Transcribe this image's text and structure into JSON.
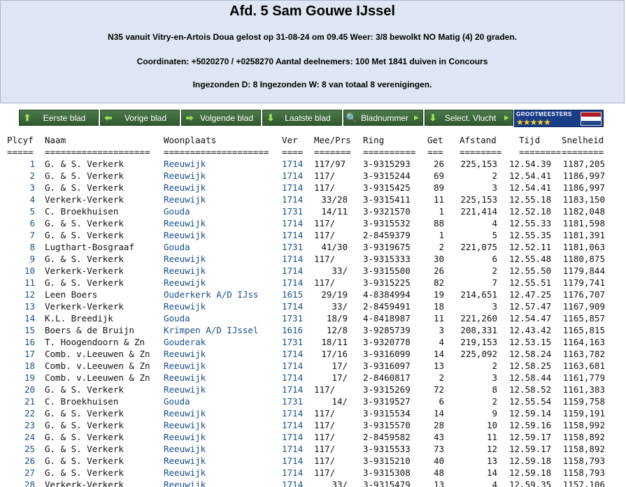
{
  "header": {
    "title": "Afd. 5 Sam Gouwe IJssel",
    "line1": "N35 vanuit Vitry-en-Artois Doua gelost op 31-08-24 om 09.45 Weer: 3/8 bewolkt NO Matig (4) 20 graden.",
    "line2": "Coordinaten: +5020270 / +0258270 Aantal deelnemers: 100 Met 1841 duiven in Concours",
    "line3": "Ingezonden D: 8 Ingezonden W: 8 van totaal 8 verenigingen."
  },
  "nav": {
    "first": "Eerste blad",
    "prev": "Vorige blad",
    "next": "Volgende blad",
    "last": "Laatste blad",
    "page_no": "Bladnummer",
    "select": "Select. Vlucht"
  },
  "logo": {
    "brand": "GROOTMEESTERS",
    "stars": "★★★★★",
    "flag_colors": [
      "#ae1c28",
      "#ffffff",
      "#21468b"
    ]
  },
  "columns": {
    "plc": "Plcyf",
    "naam": "Naam",
    "woon": "Woonplaats",
    "ver": "Ver",
    "mee": "Mee/Prs",
    "ring": "Ring",
    "get": "Get",
    "afs": "Afstand",
    "tijd": "Tijd",
    "snel": "Snelheid"
  },
  "separators": {
    "plc": "=====",
    "naam": "====================",
    "woon": "====================",
    "ver": "====",
    "mee": "=======",
    "ring": "==========",
    "get": "===",
    "afs": "========",
    "tijd": "========",
    "snel": "========"
  },
  "rows": [
    {
      "plc": "1",
      "naam": "G. & S. Verkerk",
      "woon": "Reeuwijk",
      "ver": "1714",
      "mee": "117/97",
      "ring": "3-9315293",
      "get": "26",
      "afs": "225,153",
      "tijd": "12.54.39",
      "snel": "1187,205"
    },
    {
      "plc": "2",
      "naam": "G. & S. Verkerk",
      "woon": "Reeuwijk",
      "ver": "1714",
      "mee": "117/",
      "ring": "3-9315244",
      "get": "69",
      "afs": "2",
      "tijd": "12.54.41",
      "snel": "1186,997"
    },
    {
      "plc": "3",
      "naam": "G. & S. Verkerk",
      "woon": "Reeuwijk",
      "ver": "1714",
      "mee": "117/",
      "ring": "3-9315425",
      "get": "89",
      "afs": "3",
      "tijd": "12.54.41",
      "snel": "1186,997"
    },
    {
      "plc": "4",
      "naam": "Verkerk-Verkerk",
      "woon": "Reeuwijk",
      "ver": "1714",
      "mee": "33/28",
      "ring": "3-9315411",
      "get": "11",
      "afs": "225,153",
      "tijd": "12.55.18",
      "snel": "1183,150"
    },
    {
      "plc": "5",
      "naam": "C. Broekhuisen",
      "woon": "Gouda",
      "ver": "1731",
      "mee": "14/11",
      "ring": "3-9321570",
      "get": "1",
      "afs": "221,414",
      "tijd": "12.52.18",
      "snel": "1182,048"
    },
    {
      "plc": "6",
      "naam": "G. & S. Verkerk",
      "woon": "Reeuwijk",
      "ver": "1714",
      "mee": "117/",
      "ring": "3-9315532",
      "get": "88",
      "afs": "4",
      "tijd": "12.55.33",
      "snel": "1181,598"
    },
    {
      "plc": "7",
      "naam": "G. & S. Verkerk",
      "woon": "Reeuwijk",
      "ver": "1714",
      "mee": "117/",
      "ring": "2-8459379",
      "get": "1",
      "afs": "5",
      "tijd": "12.55.35",
      "snel": "1181,391"
    },
    {
      "plc": "8",
      "naam": "Lugthart-Bosgraaf",
      "woon": "Gouda",
      "ver": "1731",
      "mee": "41/30",
      "ring": "3-9319675",
      "get": "2",
      "afs": "221,075",
      "tijd": "12.52.11",
      "snel": "1181,063"
    },
    {
      "plc": "9",
      "naam": "G. & S. Verkerk",
      "woon": "Reeuwijk",
      "ver": "1714",
      "mee": "117/",
      "ring": "3-9315333",
      "get": "30",
      "afs": "6",
      "tijd": "12.55.48",
      "snel": "1180,875"
    },
    {
      "plc": "10",
      "naam": "Verkerk-Verkerk",
      "woon": "Reeuwijk",
      "ver": "1714",
      "mee": "33/",
      "ring": "3-9315500",
      "get": "26",
      "afs": "2",
      "tijd": "12.55.50",
      "snel": "1179,844"
    },
    {
      "plc": "11",
      "naam": "G. & S. Verkerk",
      "woon": "Reeuwijk",
      "ver": "1714",
      "mee": "117/",
      "ring": "3-9315225",
      "get": "82",
      "afs": "7",
      "tijd": "12.55.51",
      "snel": "1179,741"
    },
    {
      "plc": "12",
      "naam": "Leen Boers",
      "woon": "Ouderkerk A/D IJss",
      "ver": "1615",
      "mee": "29/19",
      "ring": "4-8384994",
      "get": "19",
      "afs": "214,651",
      "tijd": "12.47.25",
      "snel": "1176,707"
    },
    {
      "plc": "13",
      "naam": "Verkerk-Verkerk",
      "woon": "Reeuwijk",
      "ver": "1714",
      "mee": "33/",
      "ring": "2-8459491",
      "get": "18",
      "afs": "3",
      "tijd": "12.57.47",
      "snel": "1167,909"
    },
    {
      "plc": "14",
      "naam": "K.L. Breedijk",
      "woon": "Gouda",
      "ver": "1731",
      "mee": "18/9",
      "ring": "4-8418987",
      "get": "11",
      "afs": "221,260",
      "tijd": "12.54.47",
      "snel": "1165,857"
    },
    {
      "plc": "15",
      "naam": "Boers & de Bruijn",
      "woon": "Krimpen A/D IJssel",
      "ver": "1616",
      "mee": "12/8",
      "ring": "3-9285739",
      "get": "3",
      "afs": "208,331",
      "tijd": "12.43.42",
      "snel": "1165,815"
    },
    {
      "plc": "16",
      "naam": "T. Hoogendoorn & Zn",
      "woon": "Gouderak",
      "ver": "1731",
      "mee": "18/11",
      "ring": "3-9320778",
      "get": "4",
      "afs": "219,153",
      "tijd": "12.53.15",
      "snel": "1164,163"
    },
    {
      "plc": "17",
      "naam": "Comb. v.Leeuwen & Zn",
      "woon": "Reeuwijk",
      "ver": "1714",
      "mee": "17/16",
      "ring": "3-9316099",
      "get": "14",
      "afs": "225,092",
      "tijd": "12.58.24",
      "snel": "1163,782"
    },
    {
      "plc": "18",
      "naam": "Comb. v.Leeuwen & Zn",
      "woon": "Reeuwijk",
      "ver": "1714",
      "mee": "17/",
      "ring": "3-9316097",
      "get": "13",
      "afs": "2",
      "tijd": "12.58.25",
      "snel": "1163,681"
    },
    {
      "plc": "19",
      "naam": "Comb. v.Leeuwen & Zn",
      "woon": "Reeuwijk",
      "ver": "1714",
      "mee": "17/",
      "ring": "2-8460817",
      "get": "2",
      "afs": "3",
      "tijd": "12.58.44",
      "snel": "1161,779"
    },
    {
      "plc": "20",
      "naam": "G. & S. Verkerk",
      "woon": "Reeuwijk",
      "ver": "1714",
      "mee": "117/",
      "ring": "3-9315269",
      "get": "72",
      "afs": "8",
      "tijd": "12.58.52",
      "snel": "1161,383"
    },
    {
      "plc": "21",
      "naam": "C. Broekhuisen",
      "woon": "Gouda",
      "ver": "1731",
      "mee": "14/",
      "ring": "3-9319527",
      "get": "6",
      "afs": "2",
      "tijd": "12.55.54",
      "snel": "1159,758"
    },
    {
      "plc": "22",
      "naam": "G. & S. Verkerk",
      "woon": "Reeuwijk",
      "ver": "1714",
      "mee": "117/",
      "ring": "3-9315534",
      "get": "14",
      "afs": "9",
      "tijd": "12.59.14",
      "snel": "1159,191"
    },
    {
      "plc": "23",
      "naam": "G. & S. Verkerk",
      "woon": "Reeuwijk",
      "ver": "1714",
      "mee": "117/",
      "ring": "3-9315570",
      "get": "28",
      "afs": "10",
      "tijd": "12.59.16",
      "snel": "1158,992"
    },
    {
      "plc": "24",
      "naam": "G. & S. Verkerk",
      "woon": "Reeuwijk",
      "ver": "1714",
      "mee": "117/",
      "ring": "2-8459582",
      "get": "43",
      "afs": "11",
      "tijd": "12.59.17",
      "snel": "1158,892"
    },
    {
      "plc": "25",
      "naam": "G. & S. Verkerk",
      "woon": "Reeuwijk",
      "ver": "1714",
      "mee": "117/",
      "ring": "3-9315533",
      "get": "73",
      "afs": "12",
      "tijd": "12.59.17",
      "snel": "1158,892"
    },
    {
      "plc": "26",
      "naam": "G. & S. Verkerk",
      "woon": "Reeuwijk",
      "ver": "1714",
      "mee": "117/",
      "ring": "3-9315210",
      "get": "40",
      "afs": "13",
      "tijd": "12.59.18",
      "snel": "1158,793"
    },
    {
      "plc": "27",
      "naam": "G. & S. Verkerk",
      "woon": "Reeuwijk",
      "ver": "1714",
      "mee": "117/",
      "ring": "3-9315308",
      "get": "48",
      "afs": "14",
      "tijd": "12.59.18",
      "snel": "1158,793"
    },
    {
      "plc": "28",
      "naam": "Verkerk-Verkerk",
      "woon": "Reeuwijk",
      "ver": "1714",
      "mee": "33/",
      "ring": "3-9315479",
      "get": "13",
      "afs": "4",
      "tijd": "12.59.35",
      "snel": "1157,106"
    }
  ]
}
